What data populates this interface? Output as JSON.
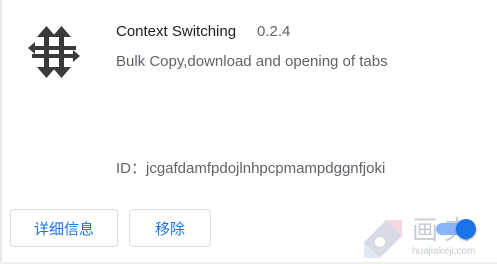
{
  "extension": {
    "name": "Context Switching",
    "version": "0.2.4",
    "description": "Bulk Copy,download and opening of tabs",
    "id_text": "ID：jcgafdamfpdojlnhpcpmampdggnfjoki",
    "icon": "context-switching-arrows-icon",
    "enabled": true
  },
  "actions": {
    "details_label": "详细信息",
    "remove_label": "移除"
  },
  "watermark": {
    "text": "画夹",
    "sub": "huajiakeji.com"
  },
  "colors": {
    "accent": "#1a73e8",
    "toggle_track": "#8ab4f8",
    "text_primary": "#202124",
    "text_secondary": "#5f6368",
    "border": "#dadce0"
  }
}
